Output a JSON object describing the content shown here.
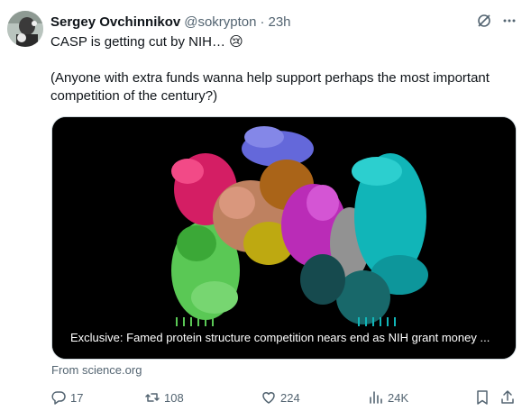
{
  "author": {
    "name": "Sergey Ovchinnikov",
    "handle": "@sokrypton",
    "separator": "·",
    "time": "23h"
  },
  "tweet": {
    "line1": "CASP is getting cut by NIH… 😢",
    "line2": "(Anyone with extra funds wanna help support perhaps the most important competition of the century?)"
  },
  "link_card": {
    "title": "Exclusive: Famed protein structure competition nears end as NIH grant money ...",
    "source": "From science.org"
  },
  "actions": {
    "replies": "17",
    "retweets": "108",
    "likes": "224",
    "views": "24K"
  },
  "icons": {
    "grok": "slashed-circle-icon",
    "more": "more-dots-icon",
    "reply": "reply-icon",
    "retweet": "retweet-icon",
    "like": "heart-icon",
    "views": "views-bars-icon",
    "bookmark": "bookmark-icon",
    "share": "share-icon"
  },
  "colors": {
    "text": "#0f1419",
    "secondary": "#536471",
    "border": "#cfd9de"
  }
}
